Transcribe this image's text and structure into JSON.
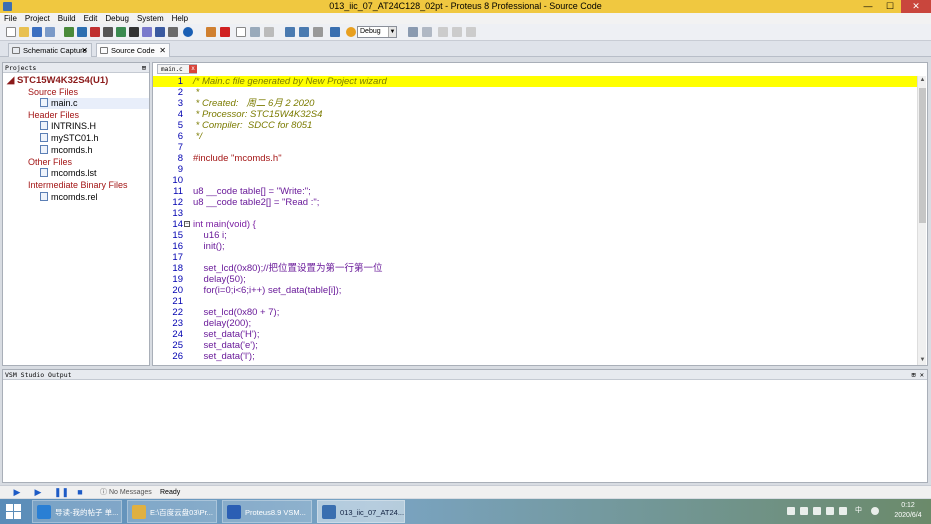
{
  "window": {
    "title": "013_iic_07_AT24C128_02pt - Proteus 8 Professional - Source Code",
    "minimize": "—",
    "maximize": "☐",
    "close": "✕"
  },
  "menu": [
    "File",
    "Project",
    "Build",
    "Edit",
    "Debug",
    "System",
    "Help"
  ],
  "toolbar": {
    "debug_select": "Debug"
  },
  "doc_tabs": [
    {
      "label": "Schematic Capture",
      "close": "✕"
    },
    {
      "label": "Source Code",
      "close": "✕"
    }
  ],
  "projects": {
    "header": "Projects",
    "pin": "⊞",
    "root": "STC15W4K32S4(U1)",
    "tree": [
      {
        "label": "Source Files",
        "kind": "folder"
      },
      {
        "label": "main.c",
        "kind": "file"
      },
      {
        "label": "Header Files",
        "kind": "folder"
      },
      {
        "label": "INTRINS.H",
        "kind": "file"
      },
      {
        "label": "mySTC01.h",
        "kind": "file"
      },
      {
        "label": "mcomds.h",
        "kind": "file"
      },
      {
        "label": "Other Files",
        "kind": "folder"
      },
      {
        "label": "mcomds.lst",
        "kind": "file"
      },
      {
        "label": "Intermediate Binary Files",
        "kind": "folder"
      },
      {
        "label": "mcomds.rel",
        "kind": "file"
      }
    ]
  },
  "editor": {
    "tab": "main.c",
    "tab_close": "x",
    "lines": [
      {
        "n": "1",
        "text": "/* Main.c file generated by New Project wizard",
        "cls": "c-com",
        "hl": true
      },
      {
        "n": "2",
        "text": " *",
        "cls": "c-com"
      },
      {
        "n": "3",
        "text": " * Created:   周二 6月 2 2020",
        "cls": "c-com"
      },
      {
        "n": "4",
        "text": " * Processor: STC15W4K32S4",
        "cls": "c-com"
      },
      {
        "n": "5",
        "text": " * Compiler:  SDCC for 8051",
        "cls": "c-com"
      },
      {
        "n": "6",
        "text": " */",
        "cls": "c-com"
      },
      {
        "n": "7",
        "text": "",
        "cls": ""
      },
      {
        "n": "8",
        "text": "#include \"mcomds.h\"",
        "cls": "c-pre"
      },
      {
        "n": "9",
        "text": "",
        "cls": ""
      },
      {
        "n": "10",
        "text": "",
        "cls": ""
      },
      {
        "n": "11",
        "text": "u8 __code table[] = \"Write:\";",
        "cls": "c-txt"
      },
      {
        "n": "12",
        "text": "u8 __code table2[] = \"Read :\";",
        "cls": "c-txt"
      },
      {
        "n": "13",
        "text": "",
        "cls": ""
      },
      {
        "n": "14",
        "text": "int main(void) {",
        "cls": "c-kw",
        "fold": "−"
      },
      {
        "n": "15",
        "text": "    u16 i;",
        "cls": "c-txt"
      },
      {
        "n": "16",
        "text": "    init();",
        "cls": "c-txt"
      },
      {
        "n": "17",
        "text": "",
        "cls": ""
      },
      {
        "n": "18",
        "text": "    set_lcd(0x80);//把位置设置为第一行第一位",
        "cls": "c-txt"
      },
      {
        "n": "19",
        "text": "    delay(50);",
        "cls": "c-txt"
      },
      {
        "n": "20",
        "text": "    for(i=0;i<6;i++) set_data(table[i]);",
        "cls": "c-txt"
      },
      {
        "n": "21",
        "text": "",
        "cls": ""
      },
      {
        "n": "22",
        "text": "    set_lcd(0x80 + 7);",
        "cls": "c-txt"
      },
      {
        "n": "23",
        "text": "    delay(200);",
        "cls": "c-txt"
      },
      {
        "n": "24",
        "text": "    set_data('H');",
        "cls": "c-txt"
      },
      {
        "n": "25",
        "text": "    set_data('e');",
        "cls": "c-txt"
      },
      {
        "n": "26",
        "text": "    set_data('l');",
        "cls": "c-txt"
      }
    ]
  },
  "output": {
    "header": "VSM Studio Output",
    "close": "⊞ ✕"
  },
  "status": {
    "no_messages": "No Messages",
    "ready": "Ready"
  },
  "taskbar": {
    "tasks": [
      {
        "label": "导读-我的帖子 单...",
        "color": "#2a7fd4",
        "active": false
      },
      {
        "label": "E:\\百度云盘03\\Pr...",
        "color": "#e0b040",
        "active": false
      },
      {
        "label": "Proteus8.9 VSM...",
        "color": "#2b5fb4",
        "active": false
      },
      {
        "label": "013_iic_07_AT24...",
        "color": "#3a6fb0",
        "active": true
      }
    ],
    "time": "0:12",
    "date": "2020/6/4",
    "ime": "中"
  },
  "colors": {
    "title_bar": "#f0c840",
    "highlight_line": "#ffff00",
    "line_number": "#0000b0",
    "folder_text": "#a31515"
  }
}
